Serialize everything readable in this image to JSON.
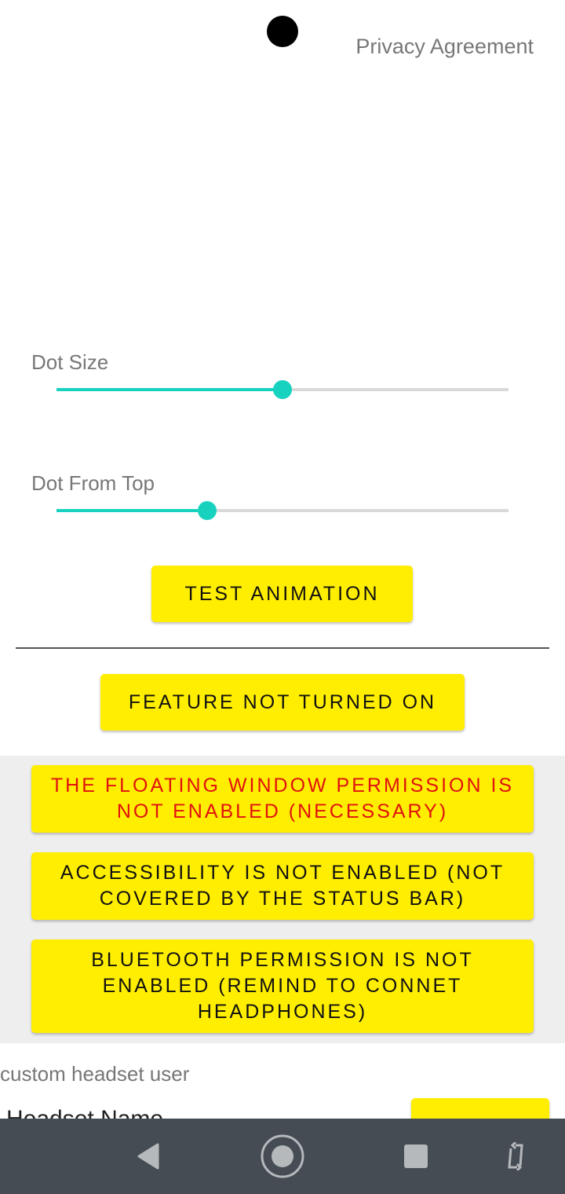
{
  "header": {
    "privacy_link": "Privacy Agreement"
  },
  "dot_size": {
    "label": "Dot Size",
    "value_fraction": 0.5
  },
  "dot_from_top": {
    "label": "Dot From Top",
    "value_fraction": 0.333
  },
  "buttons": {
    "test_animation": "TEST ANIMATION",
    "feature_status": "FEATURE NOT TURNED ON"
  },
  "permissions": [
    {
      "text": "THE FLOATING WINDOW PERMISSION IS NOT ENABLED (NECESSARY)",
      "color": "#e0120f"
    },
    {
      "text": "ACCESSIBILITY IS NOT ENABLED (NOT COVERED BY THE STATUS BAR)",
      "color": "#111111"
    },
    {
      "text": "BLUETOOTH PERMISSION IS NOT ENABLED (REMIND TO CONNET HEADPHONES)",
      "color": "#111111"
    }
  ],
  "custom_section": {
    "label": "custom headset user",
    "field_label": "Headset Name"
  },
  "colors": {
    "accent": "#18d2c0",
    "button": "#ffee00",
    "warning": "#e0120f"
  },
  "navbar": {
    "icons": [
      "back-icon",
      "home-icon",
      "recents-icon",
      "rotate-icon"
    ]
  }
}
